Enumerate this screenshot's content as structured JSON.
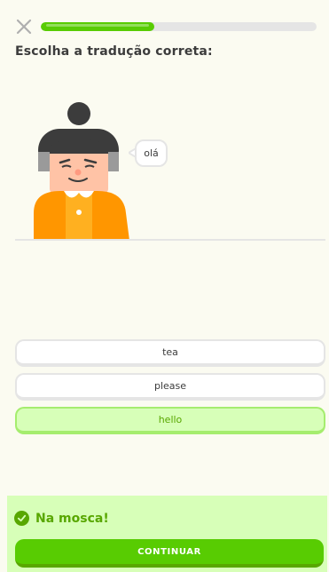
{
  "header": {
    "close_icon": "close-icon",
    "progress_fraction": 0.41
  },
  "prompt": "Escolha a tradução correta:",
  "speech_bubble": "olá",
  "options": [
    {
      "label": "tea",
      "selected": false
    },
    {
      "label": "please",
      "selected": false
    },
    {
      "label": "hello",
      "selected": true
    }
  ],
  "feedback": {
    "icon": "check-circle-icon",
    "title": "Na mosca!",
    "continue_label": "CONTINUAR"
  },
  "colors": {
    "accent": "#58cc02",
    "accent_dark": "#58a700",
    "success_bg": "#d7ffb8",
    "character_shirt": "#ff9600"
  }
}
